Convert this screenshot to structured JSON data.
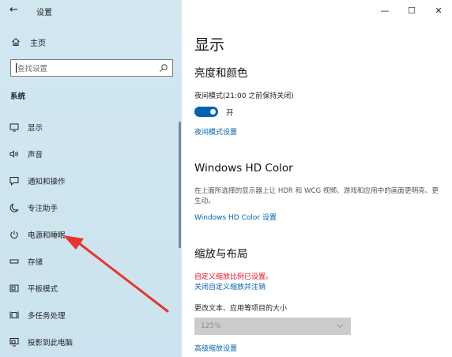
{
  "window": {
    "title": "设置",
    "controls": {
      "minimize": "—",
      "maximize": "☐",
      "close": "✕"
    }
  },
  "sidebar": {
    "home_label": "主页",
    "search": {
      "placeholder": "查找设置"
    },
    "section_label": "系统",
    "items": [
      {
        "label": "显示",
        "icon": "monitor-icon"
      },
      {
        "label": "声音",
        "icon": "speaker-icon"
      },
      {
        "label": "通知和操作",
        "icon": "notification-icon"
      },
      {
        "label": "专注助手",
        "icon": "moon-icon"
      },
      {
        "label": "电源和睡眠",
        "icon": "power-icon"
      },
      {
        "label": "存储",
        "icon": "storage-icon"
      },
      {
        "label": "平板模式",
        "icon": "tablet-mode-icon"
      },
      {
        "label": "多任务处理",
        "icon": "multitasking-icon"
      },
      {
        "label": "投影到此电脑",
        "icon": "project-icon"
      }
    ]
  },
  "main": {
    "title": "显示",
    "brightness": {
      "heading": "亮度和颜色",
      "night_light_label": "夜间模式(21:00 之前保持关闭)",
      "toggle_state": "开",
      "settings_link": "夜间模式设置"
    },
    "hdr": {
      "heading": "Windows HD Color",
      "description": "在上面所选择的显示器上让 HDR 和 WCG 视频、游戏和应用中的画面更明亮、更生动。",
      "link": "Windows HD Color 设置"
    },
    "scale": {
      "heading": "缩放与布局",
      "warning": "自定义缩放比例已设置。",
      "disable_link": "关闭自定义缩放并注销",
      "size_label": "更改文本、应用等项目的大小",
      "size_value": "125%",
      "advanced_link": "高级缩放设置"
    }
  },
  "colors": {
    "accent": "#0063b1",
    "warning": "#e81123",
    "annotation_arrow": "#e8342c",
    "sidebar_bg": "#d0e5ef"
  }
}
